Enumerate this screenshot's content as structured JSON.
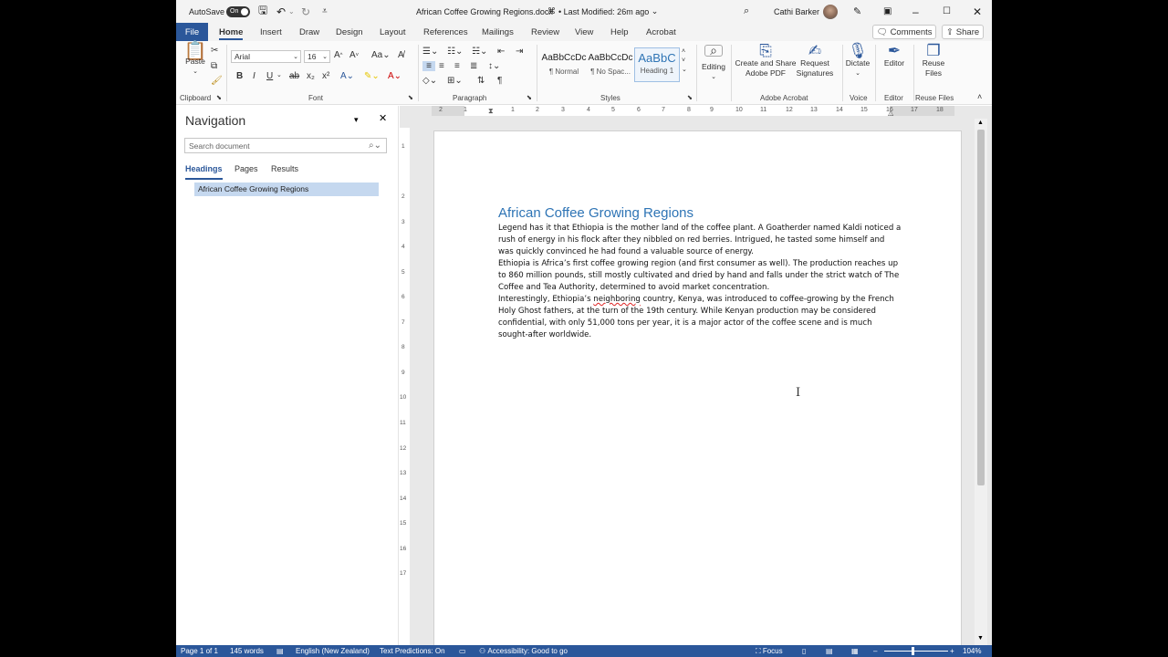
{
  "titlebar": {
    "autosave_label": "AutoSave",
    "autosave_state": "On",
    "document_name": "African Coffee Growing Regions.docx",
    "last_modified": "• Last Modified: 26m ago",
    "user_name": "Cathi Barker"
  },
  "tabs": [
    "File",
    "Home",
    "Insert",
    "Draw",
    "Design",
    "Layout",
    "References",
    "Mailings",
    "Review",
    "View",
    "Help",
    "Acrobat"
  ],
  "actions": {
    "comments": "Comments",
    "share": "Share"
  },
  "ribbon": {
    "clipboard": {
      "paste": "Paste",
      "label": "Clipboard"
    },
    "font": {
      "name": "Arial",
      "size": "16",
      "label": "Font"
    },
    "paragraph": {
      "label": "Paragraph"
    },
    "styles": {
      "label": "Styles",
      "items": [
        {
          "sample": "AaBbCcDc",
          "name": "¶ Normal"
        },
        {
          "sample": "AaBbCcDc",
          "name": "¶ No Spac..."
        },
        {
          "sample": "AaBbC",
          "name": "Heading 1"
        }
      ]
    },
    "editing": "Editing",
    "acrobat": {
      "create_share": [
        "Create and Share",
        "Adobe PDF"
      ],
      "request": [
        "Request",
        "Signatures"
      ],
      "label": "Adobe Acrobat"
    },
    "voice": {
      "dictate": "Dictate",
      "label": "Voice"
    },
    "editor": {
      "button": "Editor",
      "label": "Editor"
    },
    "reuse": {
      "button": [
        "Reuse",
        "Files"
      ],
      "label": "Reuse Files"
    }
  },
  "navigation": {
    "title": "Navigation",
    "search_placeholder": "Search document",
    "tabs": [
      "Headings",
      "Pages",
      "Results"
    ],
    "headings": [
      "African Coffee Growing Regions"
    ]
  },
  "ruler": {
    "h": [
      "2",
      "1",
      "1",
      "2",
      "3",
      "4",
      "5",
      "6",
      "7",
      "8",
      "9",
      "10",
      "11",
      "12",
      "13",
      "14",
      "15",
      "16",
      "17",
      "18"
    ],
    "v": [
      "1",
      "2",
      "3",
      "4",
      "5",
      "6",
      "7",
      "8",
      "9",
      "10",
      "11",
      "12",
      "13",
      "14",
      "15",
      "16",
      "17"
    ]
  },
  "document": {
    "heading": "African Coffee Growing Regions",
    "p1": "Legend has it that Ethiopia is the mother land of the coffee plant. A Goatherder named Kaldi noticed a rush of energy in his flock after they nibbled on red berries. Intrigued, he tasted some himself and was quickly convinced he had found a valuable source of energy.",
    "p2": "Ethiopia is Africa’s first coffee growing region (and first consumer as well). The production reaches up to 860 million pounds, still mostly cultivated and dried by hand and falls under the strict watch of The Coffee and Tea Authority, determined to avoid market concentration.",
    "p3_before": "Interestingly, Ethiopia’s ",
    "p3_flagged": "neighboring",
    "p3_after": " country, Kenya, was introduced to coffee-growing by the French Holy Ghost fathers, at the turn of the 19th century. While Kenyan production may be considered confidential, with only 51,000 tons per year, it is a major actor of the coffee scene and is much sought-after worldwide."
  },
  "statusbar": {
    "page": "Page 1 of 1",
    "words": "145 words",
    "language": "English (New Zealand)",
    "predictions": "Text Predictions: On",
    "accessibility": "Accessibility: Good to go",
    "focus": "Focus",
    "zoom": "104%"
  }
}
